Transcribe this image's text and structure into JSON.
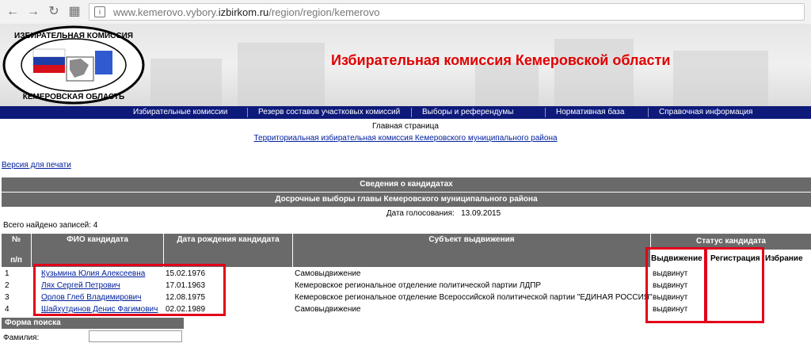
{
  "browser": {
    "url_prefix": "www.kemerovo.vybory.",
    "url_domain": "izbirkom.ru",
    "url_path": "/region/region/kemerovo"
  },
  "banner": {
    "title": "Избирательная комиссия Кемеровской области",
    "logo_top": "ИЗБИРАТЕЛЬНАЯ КОМИССИЯ",
    "logo_bottom": "КЕМЕРОВСКАЯ ОБЛАСТЬ"
  },
  "menu": [
    "Избирательные комиссии",
    "Резерв составов участковых комиссий",
    "Выборы и референдумы",
    "Нормативная база",
    "Справочная информация"
  ],
  "breadcrumb": {
    "home": "Главная страница",
    "tik": "Территориальная избирательная комиссия Кемеровского муниципального района"
  },
  "print_version": "Версия для печати",
  "section_title": "Сведения о кандидатах",
  "election_title": "Досрочные выборы главы Кемеровского муниципального района",
  "vote_date_label": "Дата голосования:",
  "vote_date": "13.09.2015",
  "records_found": "Всего найдено записей: 4",
  "table": {
    "col_num": "№",
    "col_pp": "п/п",
    "col_name": "ФИО кандидата",
    "col_birth": "Дата рождения кандидата",
    "col_subject": "Субъект выдвижения",
    "col_status": "Статус кандидата",
    "col_nomination": "Выдвижение",
    "col_registration": "Регистрация",
    "col_election": "Избрание",
    "rows": [
      {
        "num": "1",
        "name": "Кузьмина Юлия Алексеевна",
        "birth": "15.02.1976",
        "subject": "Самовыдвижение",
        "nomination": "выдвинут",
        "registration": "",
        "election": ""
      },
      {
        "num": "2",
        "name": "Лях Сергей Петрович",
        "birth": "17.01.1963",
        "subject": "Кемеровское региональное отделение политической партии ЛДПР",
        "nomination": "выдвинут",
        "registration": "",
        "election": ""
      },
      {
        "num": "3",
        "name": "Орлов Глеб Владимирович",
        "birth": "12.08.1975",
        "subject": "Кемеровское региональное отделение Всероссийской политической партии \"ЕДИНАЯ РОССИЯ\"",
        "nomination": "выдвинут",
        "registration": "",
        "election": ""
      },
      {
        "num": "4",
        "name": "Шайхутдинов Денис Фагимович",
        "birth": "02.02.1989",
        "subject": "Самовыдвижение",
        "nomination": "выдвинут",
        "registration": "",
        "election": ""
      }
    ]
  },
  "search": {
    "title": "Форма поиска",
    "surname_label": "Фамилия:",
    "surname_value": ""
  },
  "colors": {
    "menu_bg": "#0d1a7a",
    "header_bg": "#6a6a6a",
    "title_red": "#e00000",
    "highlight_red": "#e2001a",
    "link": "#00209e"
  }
}
